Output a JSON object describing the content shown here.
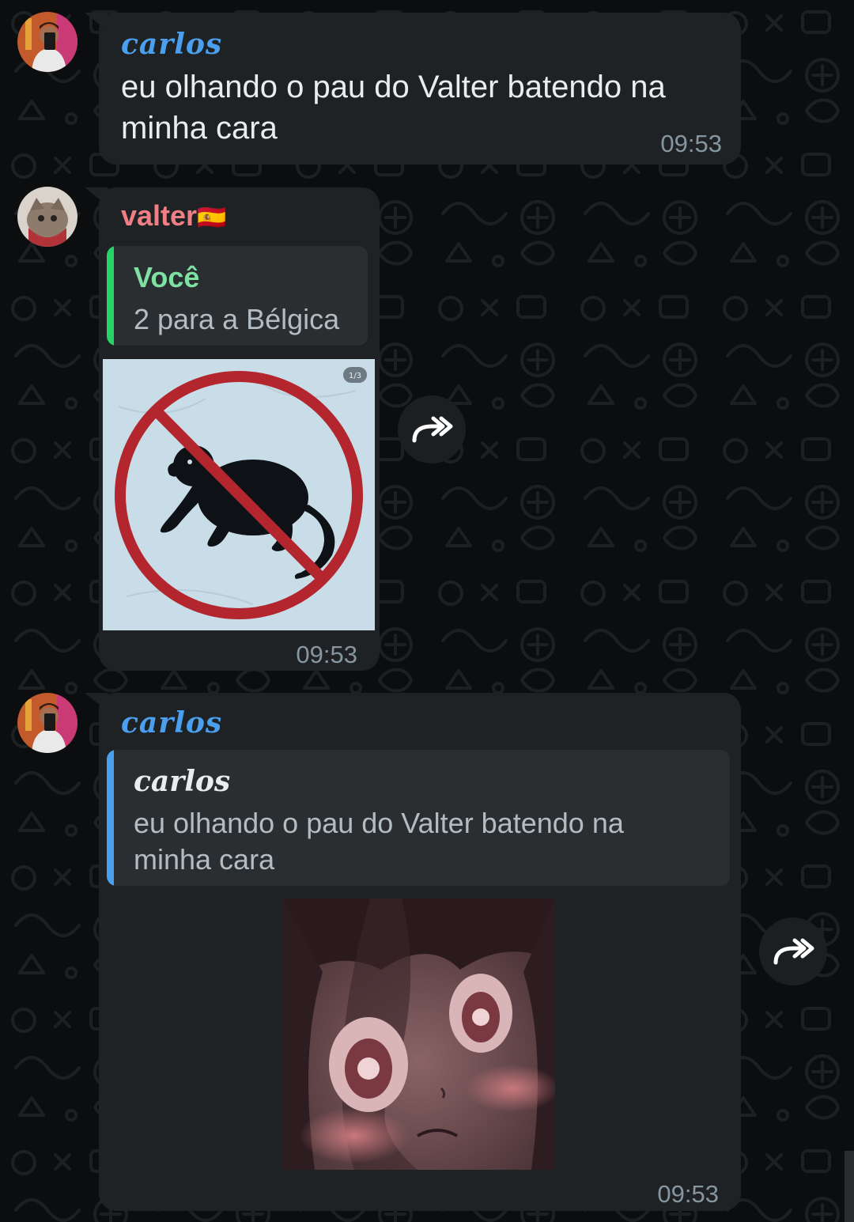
{
  "colors": {
    "background": "#0b0d0e",
    "bubble": "#1f2224",
    "quote_bg": "#2a2e31",
    "carlos_name": "#4aa0ee",
    "valter_name": "#f07f85",
    "quote_green": "#7ee0a3",
    "quote_green_bar": "#25d366",
    "quote_blue_bar": "#4aa0ee",
    "timestamp": "#8696a0"
  },
  "messages": [
    {
      "sender": "carlos",
      "text": "eu olhando o pau do Valter batendo na minha cara",
      "time": "09:53"
    },
    {
      "sender": "valter",
      "sender_flag": "🇪🇸",
      "quote": {
        "name": "Você",
        "text": "2 para a Bélgica"
      },
      "image": {
        "description_icon": "no-monkey-sign",
        "badge": "1/3"
      },
      "time": "09:53"
    },
    {
      "sender": "carlos",
      "quote": {
        "name": "carlos",
        "text": "eu olhando o pau do Valter batendo na minha cara"
      },
      "image": {
        "description_icon": "anime-girl-sticker"
      },
      "time": "09:53"
    }
  ]
}
